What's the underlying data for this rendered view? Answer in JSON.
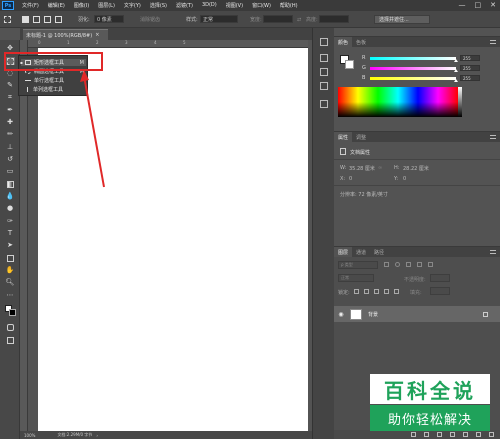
{
  "menubar": {
    "logo": "Ps",
    "items": [
      "文件(F)",
      "编辑(E)",
      "图像(I)",
      "图层(L)",
      "文字(Y)",
      "选择(S)",
      "滤镜(T)",
      "3D(D)",
      "视图(V)",
      "窗口(W)",
      "帮助(H)"
    ],
    "window_controls": [
      "—",
      "□",
      "✕"
    ]
  },
  "optionsbar": {
    "feather_label": "羽化:",
    "feather_value": "0 像素",
    "antialias_label": "消除锯齿",
    "style_label": "样式:",
    "style_value": "正常",
    "width_label": "宽度:",
    "height_label": "高度:",
    "select_mask_button": "选择并遮住..."
  },
  "document": {
    "tab_title": "未标题-1 @ 100%(RGB/8#)",
    "close_glyph": "×",
    "zoom": "100%",
    "doc_size": "文档:2.29M/0 字节"
  },
  "ruler_top_numbers": [
    "0",
    "1",
    "2",
    "3",
    "4",
    "5"
  ],
  "flyout": {
    "items": [
      {
        "label": "矩形选框工具",
        "key": "M"
      },
      {
        "label": "椭圆选框工具",
        "key": "M"
      },
      {
        "label": "单行选框工具",
        "key": ""
      },
      {
        "label": "单列选框工具",
        "key": ""
      }
    ]
  },
  "color_panel": {
    "tabs": [
      "颜色",
      "色板"
    ],
    "r_label": "R",
    "r_value": "255",
    "g_label": "G",
    "g_value": "255",
    "b_label": "B",
    "b_value": "255"
  },
  "properties_panel": {
    "tabs": [
      "属性",
      "调整"
    ],
    "section_title": "文档属性",
    "w_label": "W:",
    "w_value": "35.28 厘米",
    "h_label": "H:",
    "h_value": "28.22 厘米",
    "x_label": "X:",
    "x_value": "0",
    "y_label": "Y:",
    "y_value": "0",
    "resolution": "分辨率: 72 像素/英寸"
  },
  "layers_panel": {
    "tabs": [
      "图层",
      "通道",
      "路径"
    ],
    "kind_placeholder": "ρ 类型",
    "blend_mode": "正常",
    "opacity_label": "不透明度:",
    "lock_label": "锁定:",
    "fill_label": "填充:",
    "layer_name": "背景",
    "eye_glyph": "◉"
  },
  "watermark": {
    "title": "百科全说",
    "subtitle": "助你轻松解决"
  },
  "colors": {
    "accent_red": "#e02828",
    "watermark_green": "#1fa25a"
  }
}
